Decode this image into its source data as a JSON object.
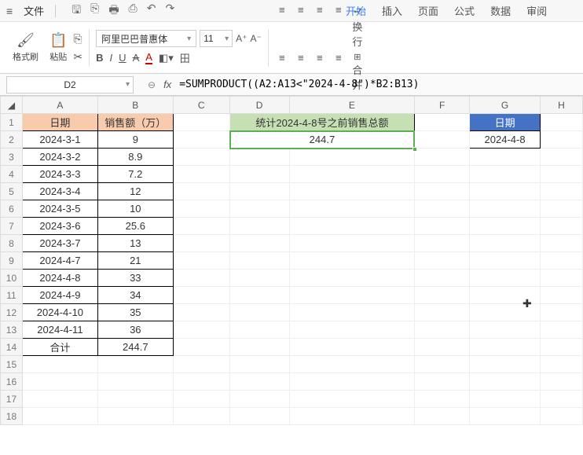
{
  "titlebar": {
    "menu_glyph": "≡",
    "file_label": "文件",
    "qat": [
      "🖫",
      "⎘",
      "🖶",
      "⎙",
      "↶",
      "↷"
    ]
  },
  "tabs": {
    "items": [
      "开始",
      "插入",
      "页面",
      "公式",
      "数据",
      "审阅"
    ],
    "active_index": 0
  },
  "ribbon": {
    "format_painter": "格式刷",
    "paste": "粘贴",
    "cut_glyph": "✂",
    "copy_glyph": "⎘",
    "font_name": "阿里巴巴普惠体",
    "font_size": "11",
    "inc_font_glyph": "A↑",
    "dec_font_glyph": "A↓",
    "bold": "B",
    "italic": "I",
    "underline": "U",
    "strike": "A",
    "fontcolor": "A",
    "border_glyph": "田",
    "wrap_label": "换行",
    "merge_label": "合并"
  },
  "namebox": {
    "value": "D2"
  },
  "formula": {
    "fx": "fx",
    "value": "=SUMPRODUCT((A2:A13<\"2024-4-8\")*B2:B13)"
  },
  "columns": [
    "A",
    "B",
    "C",
    "D",
    "E",
    "F",
    "G",
    "H"
  ],
  "rows": [
    1,
    2,
    3,
    4,
    5,
    6,
    7,
    8,
    9,
    10,
    11,
    12,
    13,
    14,
    15,
    16,
    17,
    18
  ],
  "table1": {
    "headers": {
      "a": "日期",
      "b": "销售额（万）"
    },
    "rows": [
      {
        "a": "2024-3-1",
        "b": "9"
      },
      {
        "a": "2024-3-2",
        "b": "8.9"
      },
      {
        "a": "2024-3-3",
        "b": "7.2"
      },
      {
        "a": "2024-3-4",
        "b": "12"
      },
      {
        "a": "2024-3-5",
        "b": "10"
      },
      {
        "a": "2024-3-6",
        "b": "25.6"
      },
      {
        "a": "2024-3-7",
        "b": "13"
      },
      {
        "a": "2024-4-7",
        "b": "21"
      },
      {
        "a": "2024-4-8",
        "b": "33"
      },
      {
        "a": "2024-4-9",
        "b": "34"
      },
      {
        "a": "2024-4-10",
        "b": "35"
      },
      {
        "a": "2024-4-11",
        "b": "36"
      }
    ],
    "footer": {
      "a": "合计",
      "b": "244.7"
    }
  },
  "summary": {
    "title": "统计2024-4-8号之前销售总额",
    "value": "244.7"
  },
  "lookup": {
    "header": "日期",
    "value": "2024-4-8"
  }
}
